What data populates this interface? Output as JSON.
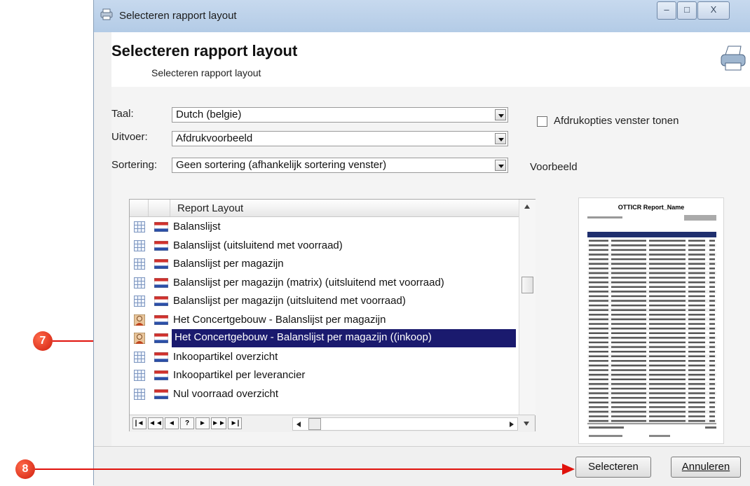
{
  "window": {
    "title": "Selecteren rapport layout",
    "controls": {
      "minimize": "–",
      "maximize": "□",
      "close": "X"
    }
  },
  "header": {
    "title": "Selecteren rapport layout",
    "subtitle": "Selecteren rapport layout",
    "icon": "printer-icon"
  },
  "form": {
    "taal_label": "Taal:",
    "taal_value": "Dutch (belgie)",
    "uitvoer_label": "Uitvoer:",
    "uitvoer_value": "Afdrukvoorbeeld",
    "sortering_label": "Sortering:",
    "sortering_value": "Geen sortering (afhankelijk sortering venster)",
    "checkbox_label": "Afdrukopties venster tonen",
    "checkbox_checked": false,
    "preview_label": "Voorbeeld"
  },
  "grid": {
    "column_header": "Report Layout",
    "rows": [
      {
        "label": "Balanslijst",
        "icon": "grid-icon",
        "selected": false
      },
      {
        "label": "Balanslijst (uitsluitend met voorraad)",
        "icon": "grid-icon",
        "selected": false
      },
      {
        "label": "Balanslijst per magazijn",
        "icon": "grid-icon",
        "selected": false
      },
      {
        "label": "Balanslijst per magazijn (matrix) (uitsluitend met voorraad)",
        "icon": "grid-icon",
        "selected": false
      },
      {
        "label": "Balanslijst per magazijn (uitsluitend met voorraad)",
        "icon": "grid-icon",
        "selected": false
      },
      {
        "label": "Het Concertgebouw - Balanslijst per magazijn",
        "icon": "user-icon",
        "selected": false
      },
      {
        "label": "Het Concertgebouw - Balanslijst per magazijn ((inkoop)",
        "icon": "user-icon",
        "selected": true
      },
      {
        "label": "Inkoopartikel overzicht",
        "icon": "grid-icon",
        "selected": false
      },
      {
        "label": "Inkoopartikel per leverancier",
        "icon": "grid-icon",
        "selected": false
      },
      {
        "label": "Nul voorraad overzicht",
        "icon": "grid-icon",
        "selected": false
      }
    ],
    "nav_buttons": [
      "|◄",
      "◄◄",
      "◄",
      "?",
      "►",
      "►►",
      "►|"
    ]
  },
  "preview": {
    "report_title": "OTTICR Report_Name"
  },
  "buttons": {
    "select": "Selecteren",
    "cancel": "Annuleren"
  },
  "callouts": [
    "7",
    "8"
  ],
  "colors": {
    "selection": "#1a1a6e",
    "callout": "#e0120c",
    "titlebar": "#c7d9ee"
  }
}
